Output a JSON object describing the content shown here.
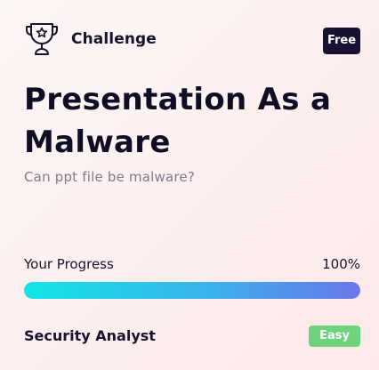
{
  "card": {
    "icon": "trophy-star-icon",
    "type_label": "Challenge",
    "price_badge": "Free",
    "title": "Presentation As a Malware",
    "subtitle": "Can ppt file be malware?",
    "progress": {
      "label": "Your Progress",
      "value_text": "100%",
      "fraction": 1.0
    },
    "role": "Security Analyst",
    "difficulty": "Easy"
  },
  "colors": {
    "badge_dark": "#151331",
    "easy_green": "#6dd47d",
    "progress_start": "#11e6e6",
    "progress_end": "#6a77ea"
  }
}
